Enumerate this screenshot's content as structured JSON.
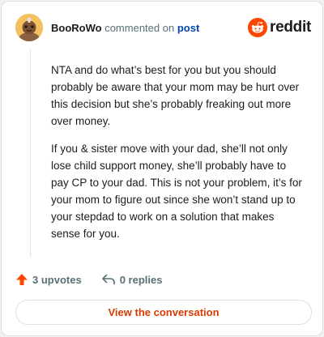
{
  "comment": {
    "username": "BooRoWo",
    "commented_on": "commented on",
    "post_link": "post",
    "paragraphs": [
      "NTA and do what’s best for you but you should probably be aware that your mom may be hurt over this decision but she’s probably freaking out more over money.",
      "If you & sister move with your dad, she’ll not only lose child support money, she’ll probably have to pay CP to your dad. This is not your problem, it’s for your mom to figure out since she won’t stand up to your stepdad to work on a solution that makes sense for you."
    ]
  },
  "brand": {
    "wordmark": "reddit",
    "icon": "reddit-snoo-icon",
    "color": "#ff4500"
  },
  "actions": {
    "upvotes": "3 upvotes",
    "replies": "0 replies"
  },
  "footer": {
    "view_label": "View the conversation"
  },
  "colors": {
    "accent": "#d93a00",
    "upvote": "#ff4500",
    "link": "#0045ac"
  }
}
